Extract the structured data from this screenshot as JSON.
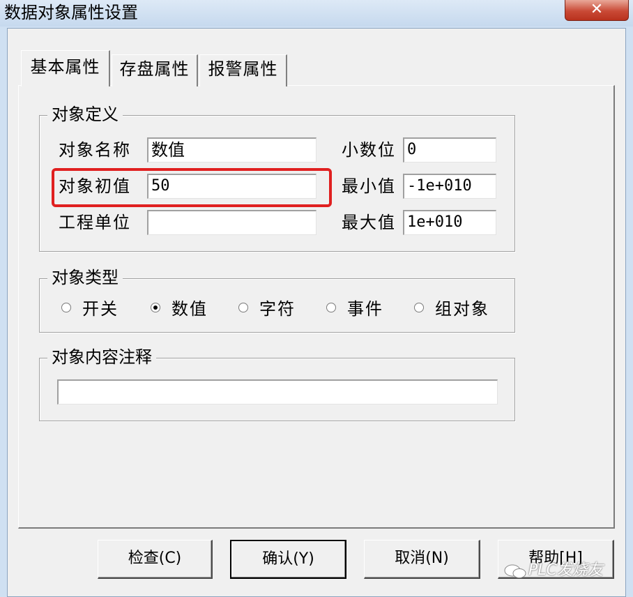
{
  "window": {
    "title": "数据对象属性设置",
    "close_glyph": "✕"
  },
  "tabs": [
    {
      "label": "基本属性",
      "active": true
    },
    {
      "label": "存盘属性",
      "active": false
    },
    {
      "label": "报警属性",
      "active": false
    }
  ],
  "definition": {
    "legend": "对象定义",
    "name_label": "对象名称",
    "name_value": "数值",
    "init_label": "对象初值",
    "init_value": "50",
    "unit_label": "工程单位",
    "unit_value": "",
    "decimals_label": "小数位",
    "decimals_value": "0",
    "min_label": "最小值",
    "min_value": "-1e+010",
    "max_label": "最大值",
    "max_value": "1e+010"
  },
  "object_type": {
    "legend": "对象类型",
    "options": [
      {
        "label": "开关",
        "selected": false
      },
      {
        "label": "数值",
        "selected": true
      },
      {
        "label": "字符",
        "selected": false
      },
      {
        "label": "事件",
        "selected": false
      },
      {
        "label": "组对象",
        "selected": false
      }
    ]
  },
  "note": {
    "legend": "对象内容注释",
    "value": ""
  },
  "buttons": {
    "check": "检查(C)",
    "ok": "确认(Y)",
    "cancel": "取消(N)",
    "help": "帮助[H]"
  },
  "watermark": "PLC发烧友",
  "colors": {
    "highlight": "#e02020",
    "close": "#c94a36"
  }
}
